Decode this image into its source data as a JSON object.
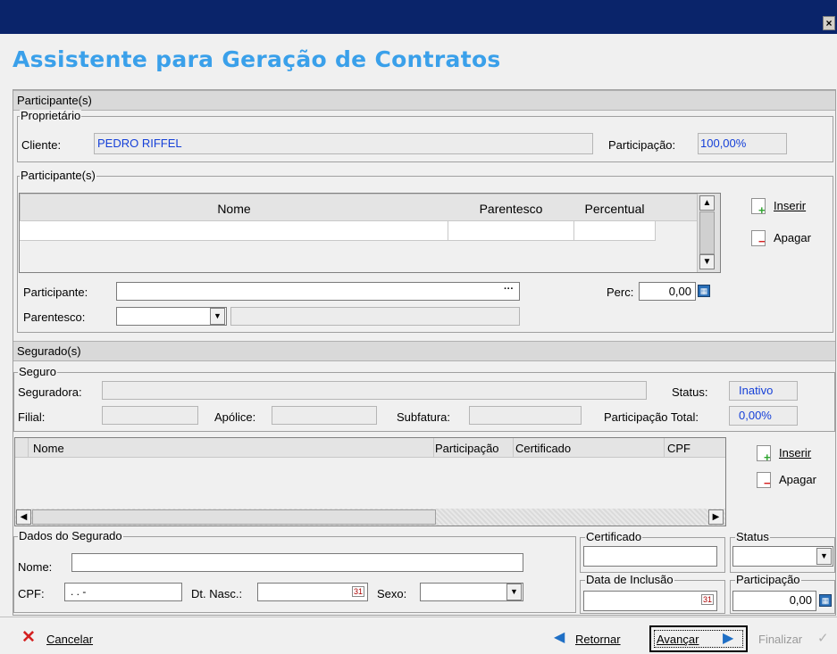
{
  "window": {
    "close_glyph": "×"
  },
  "title": "Assistente para Geração de Contratos",
  "participantes_section": {
    "header": "Participante(s)",
    "proprietario": {
      "group_label": "Proprietário",
      "cliente_label": "Cliente:",
      "cliente_value": "PEDRO RIFFEL",
      "participacao_label": "Participação:",
      "participacao_value": "100,00%"
    },
    "participantes_group": {
      "group_label": "Participante(s)",
      "columns": [
        "Nome",
        "Parentesco",
        "Percentual"
      ],
      "inserir_label": "Inserir",
      "apagar_label": "Apagar",
      "participante_label": "Participante:",
      "ellipsis": "···",
      "perc_label": "Perc:",
      "perc_value": "0,00",
      "parentesco_label": "Parentesco:"
    }
  },
  "segurados_section": {
    "header": "Segurado(s)",
    "seguro": {
      "group_label": "Seguro",
      "seguradora_label": "Seguradora:",
      "status_label": "Status:",
      "status_value": "Inativo",
      "filial_label": "Filial:",
      "apolice_label": "Apólice:",
      "subfatura_label": "Subfatura:",
      "participacao_total_label": "Participação Total:",
      "participacao_total_value": "0,00%"
    },
    "grid": {
      "columns": [
        "Nome",
        "Participação",
        "Certificado",
        "CPF"
      ],
      "inserir_label": "Inserir",
      "apagar_label": "Apagar"
    },
    "dados": {
      "group_label": "Dados do Segurado",
      "nome_label": "Nome:",
      "cpf_label": "CPF:",
      "cpf_mask": " .   .   -",
      "dtnasc_label": "Dt. Nasc.:",
      "sexo_label": "Sexo:",
      "certificado_label": "Certificado",
      "status_label": "Status",
      "data_inclusao_label": "Data de Inclusão",
      "participacao_label": "Participação",
      "participacao_value": "0,00"
    }
  },
  "footer": {
    "cancelar": "Cancelar",
    "retornar": "Retornar",
    "avancar": "Avançar",
    "finalizar": "Finalizar"
  },
  "colors": {
    "title": "#3aa0ea",
    "blue_value": "#1540d8",
    "titlebar": "#0a246a"
  }
}
